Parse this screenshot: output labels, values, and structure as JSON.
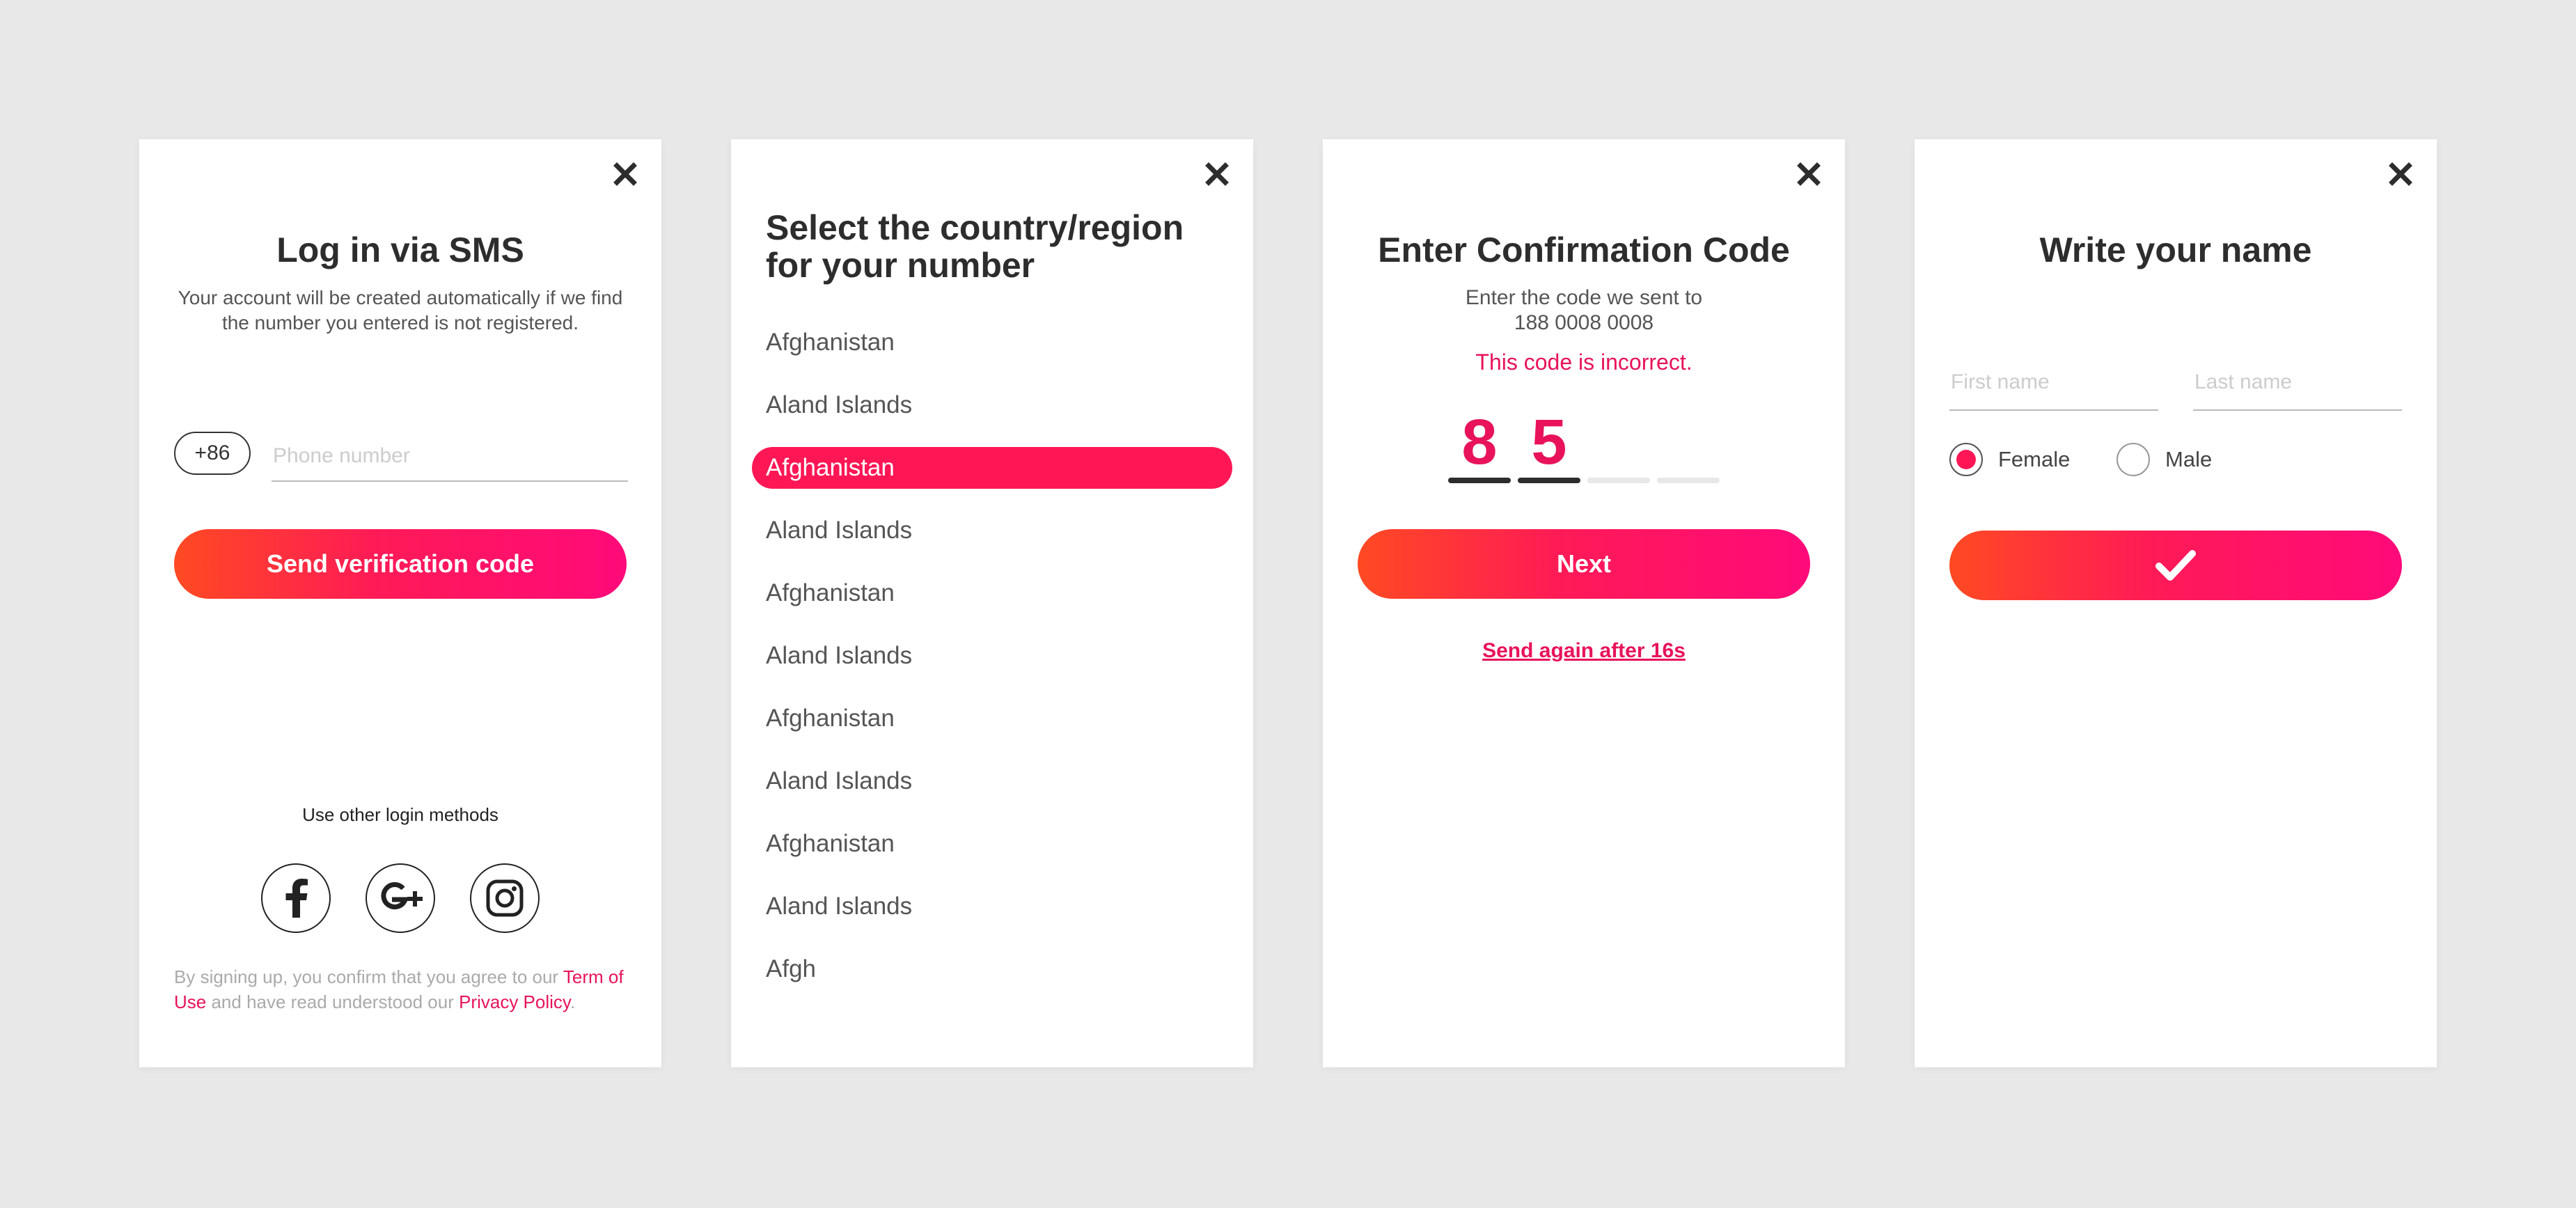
{
  "login": {
    "title": "Log in via SMS",
    "subtitle": "Your account will be created automatically if we find the number you entered is not registered.",
    "country_code": "+86",
    "phone_placeholder": "Phone number",
    "send_button": "Send verification code",
    "other_methods_label": "Use other login methods",
    "social_icons": [
      "facebook-icon",
      "google-plus-icon",
      "instagram-icon"
    ],
    "legal": {
      "prefix": "By signing up, you confirm that you agree to our ",
      "terms_link": "Term of Use",
      "middle": " and have read understood our ",
      "privacy_link": "Privacy Policy",
      "suffix": "."
    }
  },
  "country_select": {
    "title": "Select the country/region for your number",
    "items": [
      {
        "label": "Afghanistan"
      },
      {
        "label": "Aland Islands"
      },
      {
        "label": "Afghanistan",
        "selected": true
      },
      {
        "label": "Aland Islands"
      },
      {
        "label": "Afghanistan"
      },
      {
        "label": "Aland Islands"
      },
      {
        "label": "Afghanistan"
      },
      {
        "label": "Aland Islands"
      },
      {
        "label": "Afghanistan"
      },
      {
        "label": "Aland Islands"
      },
      {
        "label": "Afgh"
      }
    ]
  },
  "confirm": {
    "title": "Enter Confirmation Code",
    "subtitle_line1": "Enter the code we sent to",
    "phone": "188 0008 0008",
    "error": "This code is incorrect.",
    "digits": [
      "8",
      "5",
      "",
      ""
    ],
    "next_button": "Next",
    "resend": "Send again after 16s"
  },
  "name": {
    "title": "Write your name",
    "first_placeholder": "First name",
    "last_placeholder": "Last name",
    "gender_options": [
      {
        "label": "Female",
        "selected": true
      },
      {
        "label": "Male",
        "selected": false
      }
    ],
    "confirm_icon": "check-icon"
  },
  "colors": {
    "accent": "#ff1755",
    "gradient_start": "#ff4a22",
    "gradient_end": "#ff0a7a",
    "background": "#e8e8e8"
  }
}
